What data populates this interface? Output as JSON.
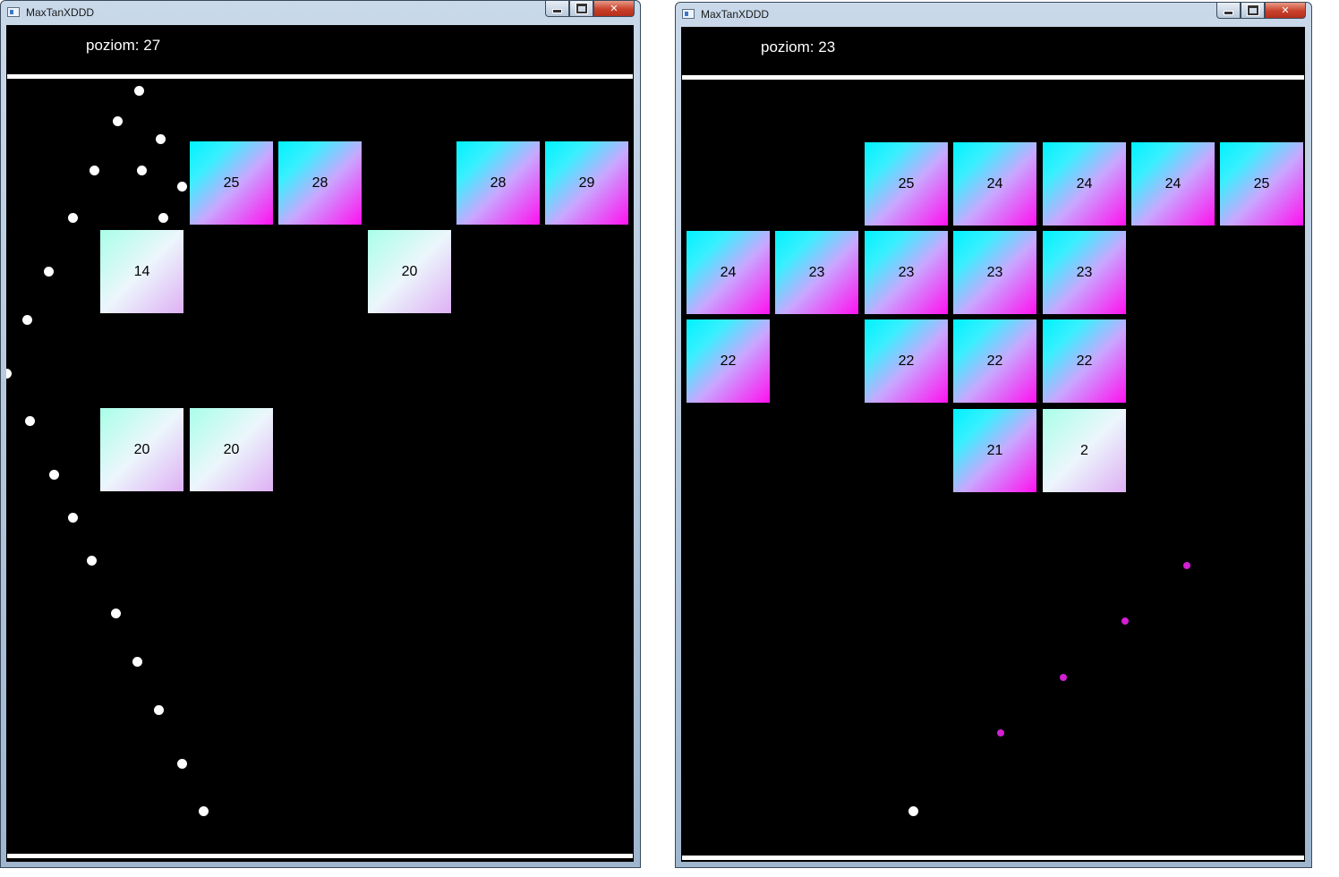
{
  "windows": [
    {
      "id": "left",
      "title": "MaxTanXDDD",
      "level_text": "poziom: 27",
      "bricks": [
        {
          "value": "25",
          "style": "strong"
        },
        {
          "value": "28",
          "style": "strong"
        },
        {
          "value": "28",
          "style": "strong"
        },
        {
          "value": "29",
          "style": "strong"
        },
        {
          "value": "14",
          "style": "faded"
        },
        {
          "value": "20",
          "style": "faded"
        },
        {
          "value": "20",
          "style": "faded"
        },
        {
          "value": "20",
          "style": "faded"
        }
      ]
    },
    {
      "id": "right",
      "title": "MaxTanXDDD",
      "level_text": "poziom: 23",
      "bricks": [
        {
          "value": "25",
          "style": "strong"
        },
        {
          "value": "24",
          "style": "strong"
        },
        {
          "value": "24",
          "style": "strong"
        },
        {
          "value": "24",
          "style": "strong"
        },
        {
          "value": "25",
          "style": "strong"
        },
        {
          "value": "24",
          "style": "strong"
        },
        {
          "value": "23",
          "style": "strong"
        },
        {
          "value": "23",
          "style": "strong"
        },
        {
          "value": "23",
          "style": "strong"
        },
        {
          "value": "23",
          "style": "strong"
        },
        {
          "value": "22",
          "style": "strong"
        },
        {
          "value": "22",
          "style": "strong"
        },
        {
          "value": "22",
          "style": "strong"
        },
        {
          "value": "22",
          "style": "strong"
        },
        {
          "value": "21",
          "style": "strong"
        },
        {
          "value": "2",
          "style": "faded"
        }
      ]
    }
  ],
  "colors": {
    "background": "#000000",
    "ball": "#ffffff",
    "aim_dot": "#d220d2",
    "brick_gradient_start": "#00f2ff",
    "brick_gradient_end": "#ff10f0",
    "faded_brick_start": "#a8ffe8",
    "faded_brick_end": "#deb0f4"
  }
}
